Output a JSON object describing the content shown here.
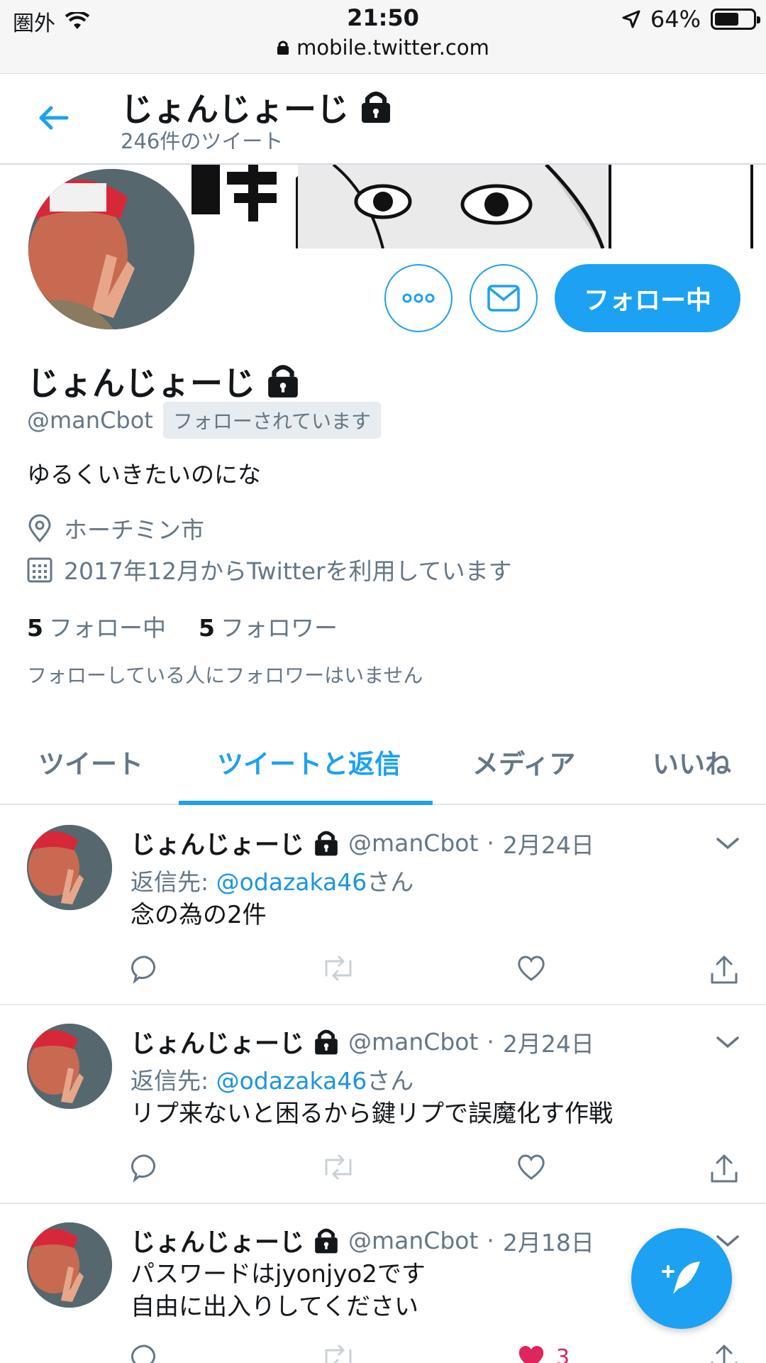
{
  "status_bar": {
    "carrier": "圏外",
    "time": "21:50",
    "battery": "64%",
    "battery_level": 0.64,
    "url": "mobile.twitter.com"
  },
  "header": {
    "title": "じょんじょーじ",
    "tweet_count": "246件のツイート"
  },
  "profile": {
    "name": "じょんじょーじ",
    "handle": "@manCbot",
    "follows_you": "フォローされています",
    "follow_button": "フォロー中",
    "bio": "ゆるくいきたいのにな",
    "location": "ホーチミン市",
    "joined": "2017年12月からTwitterを利用しています",
    "following_count": "5",
    "following_label": "フォロー中",
    "followers_count": "5",
    "followers_label": "フォロワー",
    "no_mutual_followers": "フォローしている人にフォロワーはいません"
  },
  "tabs": [
    {
      "label": "ツイート",
      "active": false
    },
    {
      "label": "ツイートと返信",
      "active": true
    },
    {
      "label": "メディア",
      "active": false
    },
    {
      "label": "いいね",
      "active": false
    }
  ],
  "tweets": [
    {
      "name": "じょんじょーじ",
      "handle": "@manCbot",
      "dot": "·",
      "date": "2月24日",
      "reply_prefix": "返信先: ",
      "reply_to": "@odazaka46",
      "reply_suffix": "さん",
      "text": "念の為の2件",
      "likes": ""
    },
    {
      "name": "じょんじょーじ",
      "handle": "@manCbot",
      "dot": "·",
      "date": "2月24日",
      "reply_prefix": "返信先: ",
      "reply_to": "@odazaka46",
      "reply_suffix": "さん",
      "text": "リプ来ないと困るから鍵リプで誤魔化す作戦",
      "likes": ""
    },
    {
      "name": "じょんじょーじ",
      "handle": "@manCbot",
      "dot": "·",
      "date": "2月18日",
      "text_line1": "パスワードはjyonjyo2です",
      "text_line2": "自由に出入りしてください",
      "likes": "3"
    }
  ],
  "colors": {
    "accent": "#1da1f2",
    "like": "#e0245e",
    "secondary_text": "#657786"
  }
}
